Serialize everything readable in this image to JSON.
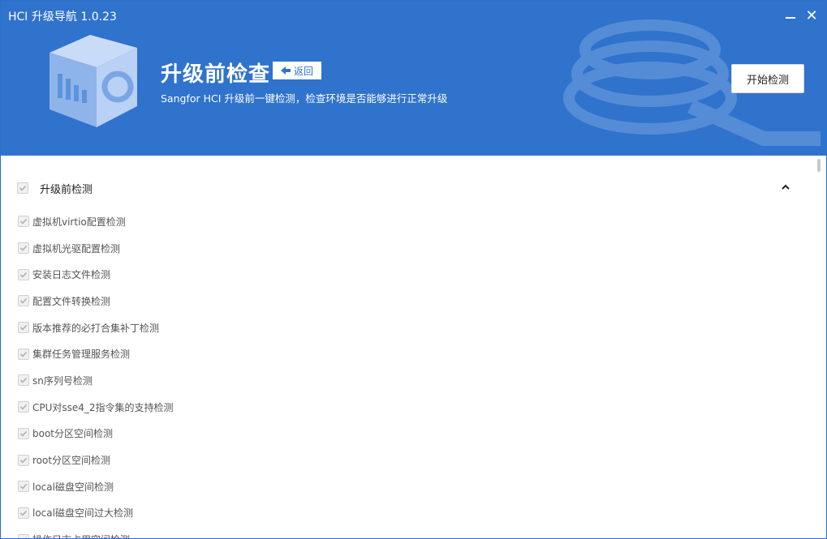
{
  "window": {
    "title": "HCI 升级导航 1.0.23",
    "minimize_icon": "minimize-icon",
    "close_icon": "close-icon",
    "close_glyph": "✕"
  },
  "header": {
    "heading": "升级前检查",
    "back_label": "返回",
    "subtitle": "Sangfor HCI 升级前一键检测，检查环境是否能够进行正常升级",
    "start_label": "开始检测",
    "accent_color": "#2f73cd"
  },
  "section": {
    "label": "升级前检测",
    "collapse_icon": "chevron-up-icon",
    "items": [
      {
        "label": "虚拟机virtio配置检测",
        "checked": true
      },
      {
        "label": "虚拟机光驱配置检测",
        "checked": true
      },
      {
        "label": "安装日志文件检测",
        "checked": true
      },
      {
        "label": "配置文件转换检测",
        "checked": true
      },
      {
        "label": "版本推荐的必打合集补丁检测",
        "checked": true
      },
      {
        "label": "集群任务管理服务检测",
        "checked": true
      },
      {
        "label": "sn序列号检测",
        "checked": true
      },
      {
        "label": "CPU对sse4_2指令集的支持检测",
        "checked": true
      },
      {
        "label": "boot分区空间检测",
        "checked": true
      },
      {
        "label": "root分区空间检测",
        "checked": true
      },
      {
        "label": "local磁盘空间检测",
        "checked": true
      },
      {
        "label": "local磁盘空间过大检测",
        "checked": true
      },
      {
        "label": "操作日志占用空间检测",
        "checked": true
      }
    ]
  }
}
